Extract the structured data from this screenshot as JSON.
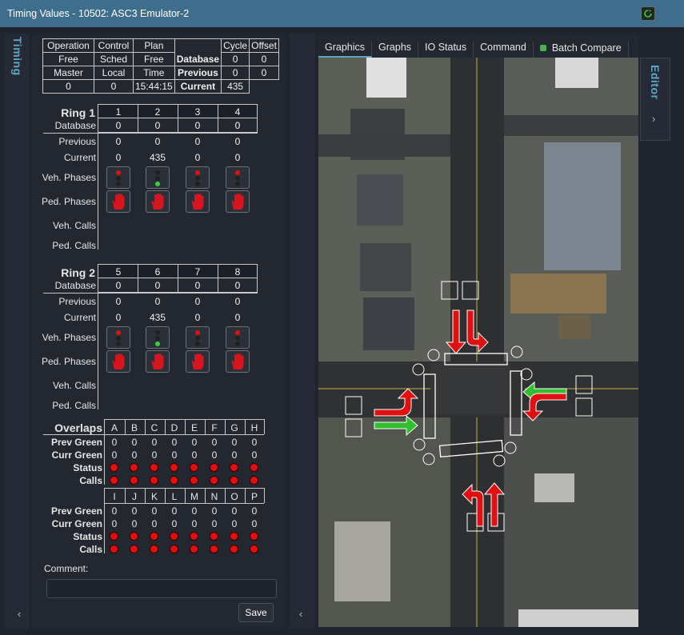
{
  "window": {
    "title": "Timing Values - 10502: ASC3 Emulator-2"
  },
  "side": {
    "timing_label": "Timing",
    "editor_label": "Editor"
  },
  "header": {
    "cols": [
      "Operation",
      "Control",
      "Plan",
      "Cycle",
      "Offset"
    ],
    "operation": "Free",
    "control": "Sched",
    "plan": "Free",
    "master_label": "Master",
    "local_label": "Local",
    "time_label": "Time",
    "master": "0",
    "local": "0",
    "time": "15:44:15",
    "database_label": "Database",
    "previous_label": "Previous",
    "current_label": "Current",
    "cycle_db": "0",
    "cycle_prev": "0",
    "cycle_curr": "435",
    "offset_db": "0",
    "offset_prev": "0"
  },
  "ring1": {
    "label": "Ring 1",
    "phases": [
      "1",
      "2",
      "3",
      "4"
    ],
    "database": [
      "0",
      "0",
      "0",
      "0"
    ],
    "previous": [
      "0",
      "0",
      "0",
      "0"
    ],
    "current": [
      "0",
      "435",
      "0",
      "0"
    ],
    "veh_state": [
      "red",
      "green",
      "red",
      "red"
    ]
  },
  "ring2": {
    "label": "Ring 2",
    "phases": [
      "5",
      "6",
      "7",
      "8"
    ],
    "database": [
      "0",
      "0",
      "0",
      "0"
    ],
    "previous": [
      "0",
      "0",
      "0",
      "0"
    ],
    "current": [
      "0",
      "435",
      "0",
      "0"
    ],
    "veh_state": [
      "red",
      "green",
      "red",
      "red"
    ]
  },
  "row_labels": {
    "database": "Database",
    "previous": "Previous",
    "current": "Current",
    "veh_phases": "Veh. Phases",
    "ped_phases": "Ped. Phases",
    "veh_calls": "Veh. Calls",
    "ped_calls": "Ped. Calls"
  },
  "overlaps": {
    "label": "Overlaps",
    "group1": [
      "A",
      "B",
      "C",
      "D",
      "E",
      "F",
      "G",
      "H"
    ],
    "group2": [
      "I",
      "J",
      "K",
      "L",
      "M",
      "N",
      "O",
      "P"
    ],
    "prev_green_label": "Prev Green",
    "curr_green_label": "Curr Green",
    "status_label": "Status",
    "calls_label": "Calls",
    "prev_green_1": [
      "0",
      "0",
      "0",
      "0",
      "0",
      "0",
      "0",
      "0"
    ],
    "curr_green_1": [
      "0",
      "0",
      "0",
      "0",
      "0",
      "0",
      "0",
      "0"
    ],
    "prev_green_2": [
      "0",
      "0",
      "0",
      "0",
      "0",
      "0",
      "0",
      "0"
    ],
    "curr_green_2": [
      "0",
      "0",
      "0",
      "0",
      "0",
      "0",
      "0",
      "0"
    ]
  },
  "comment": {
    "label": "Comment:",
    "value": ""
  },
  "buttons": {
    "save": "Save"
  },
  "tabs": [
    "Graphics",
    "Graphs",
    "IO Status",
    "Command",
    "Batch Compare"
  ],
  "colors": {
    "accent": "#5ea6c4",
    "red": "#e01010",
    "green": "#2fbf2f",
    "batch_dot": "#4caf50"
  }
}
